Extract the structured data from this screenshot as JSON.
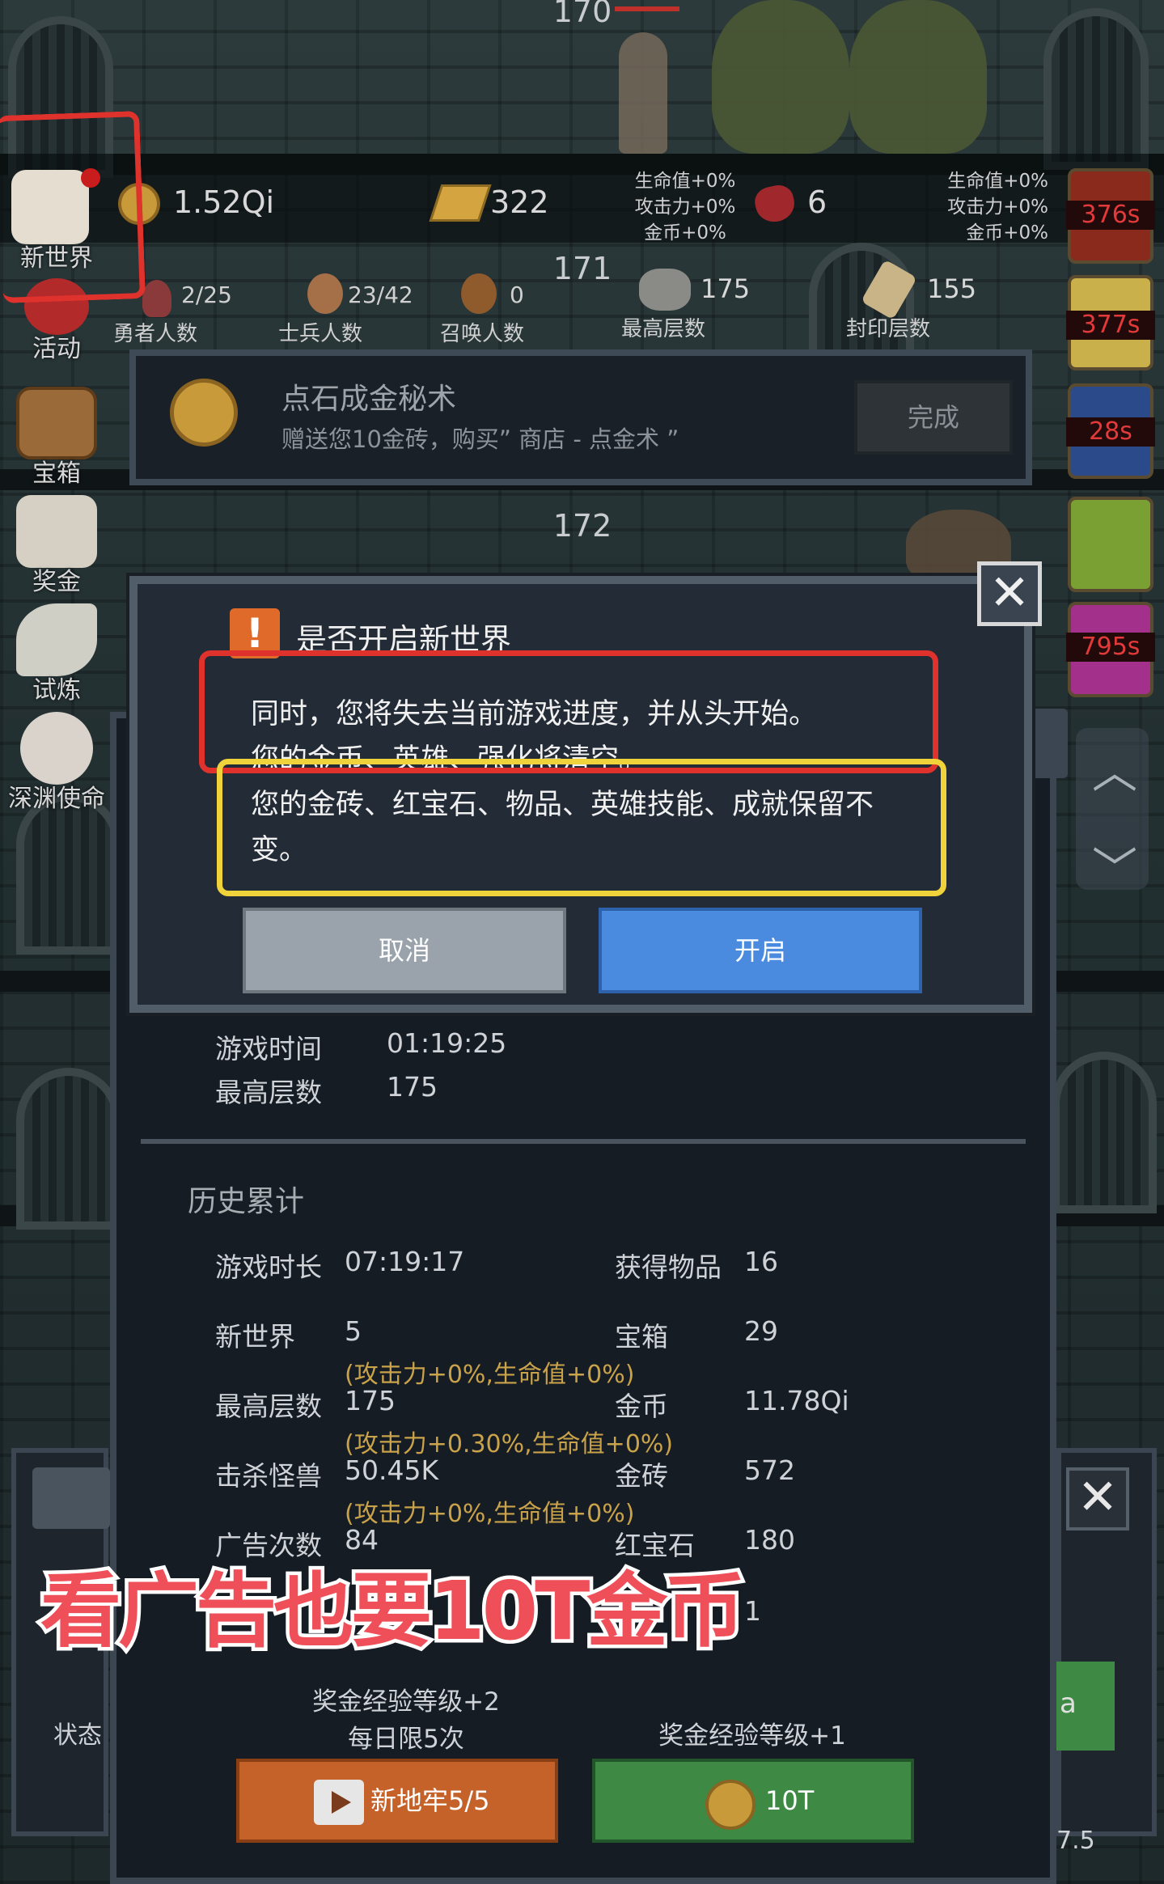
{
  "floors": {
    "f170": "170",
    "f171": "171",
    "f172": "172"
  },
  "resources": {
    "gold": "1.52Qi",
    "gold_bars": "322",
    "rubies": "6",
    "buff_left": [
      "生命值+0%",
      "攻击力+0%",
      "金币+0%"
    ],
    "buff_right": [
      "生命值+0%",
      "攻击力+0%",
      "金币+0%"
    ]
  },
  "counters": [
    {
      "label": "勇者人数",
      "value": "2/25"
    },
    {
      "label": "士兵人数",
      "value": "23/42"
    },
    {
      "label": "召唤人数",
      "value": "0"
    },
    {
      "label": "最高层数",
      "value": "175"
    },
    {
      "label": "封印层数",
      "value": "155"
    }
  ],
  "sidebar_left": [
    "新世界",
    "活动",
    "宝箱",
    "奖金",
    "试炼",
    "深渊使命"
  ],
  "sidebar_right_timers": [
    "376s",
    "377s",
    "28s",
    "795s"
  ],
  "quest": {
    "title": "点石成金秘术",
    "desc": "赠送您10金砖，购买” 商店 - 点金术 ”",
    "button": "完成"
  },
  "dialog": {
    "title": "是否开启新世界",
    "line1": "同时，您将失去当前游戏进度，并从头开始。",
    "line2": "您的金币、英雄、强化将清空。",
    "line3a": "您的金砖、红宝石、物品、英雄技能、成就保留不",
    "line3b": "变。",
    "cancel": "取消",
    "confirm": "开启"
  },
  "current": {
    "play_time_label": "游戏时间",
    "play_time": "01:19:25",
    "max_floor_label": "最高层数",
    "max_floor": "175"
  },
  "history": {
    "title": "历史累计",
    "rows": [
      {
        "k1": "游戏时长",
        "v1": "07:19:17",
        "k2": "获得物品",
        "v2": "16",
        "bonus": ""
      },
      {
        "k1": "新世界",
        "v1": "5",
        "k2": "宝箱",
        "v2": "29",
        "bonus": "(攻击力+0%,生命值+0%)"
      },
      {
        "k1": "最高层数",
        "v1": "175",
        "k2": "金币",
        "v2": "11.78Qi",
        "bonus": "(攻击力+0.30%,生命值+0%)"
      },
      {
        "k1": "击杀怪兽",
        "v1": "50.45K",
        "k2": "金砖",
        "v2": "572",
        "bonus": "(攻击力+0%,生命值+0%)"
      },
      {
        "k1": "广告次数",
        "v1": "84",
        "k2": "红宝石",
        "v2": "180",
        "bonus": ""
      }
    ],
    "extra_value": "1"
  },
  "bottom": {
    "left_note1": "奖金经验等级+2",
    "left_note2": "每日限5次",
    "right_note": "奖金经验等级+1",
    "left_btn": "新地牢5/5",
    "right_btn": "10T",
    "status_label": "状态",
    "side_a": "a",
    "side_5": "7.5"
  },
  "overlay_caption": "看广告也要10T金币",
  "colors": {
    "accent_blue": "#4a8be0",
    "accent_green": "#3e8a45",
    "accent_orange": "#c4622a",
    "annotation_red": "#e0322d",
    "annotation_yellow": "#f0d23a"
  }
}
